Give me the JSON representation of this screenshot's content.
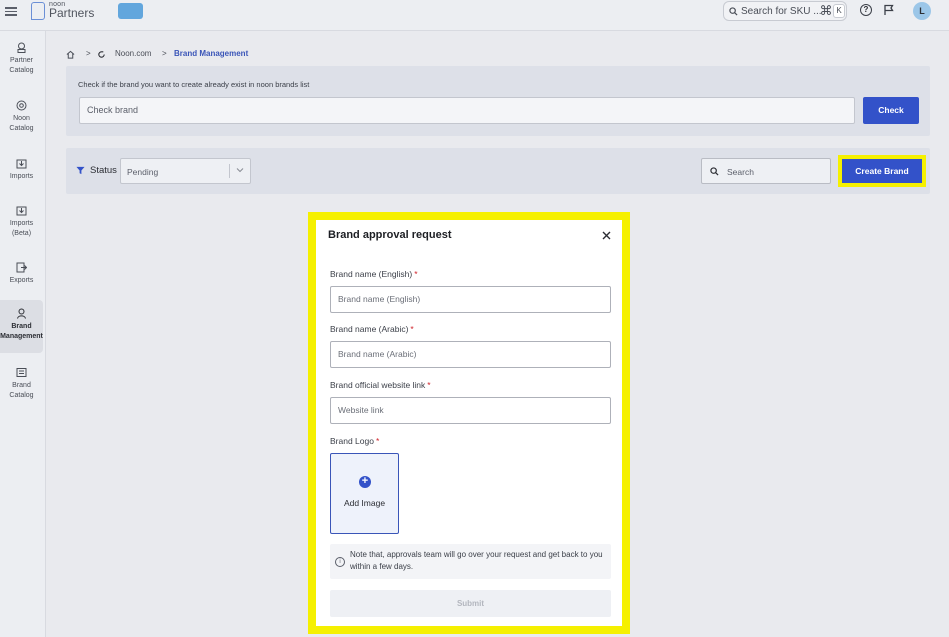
{
  "header": {
    "logo_small": "noon",
    "logo_text": "Partners",
    "search_placeholder": "Search for SKU ...",
    "shortcut_cmd": "⌘",
    "shortcut_key": "K",
    "help_glyph": "?",
    "avatar_initial": "L"
  },
  "sidebar": {
    "items": [
      {
        "line1": "Partner",
        "line2": "Catalog",
        "icon": "partner-catalog-icon"
      },
      {
        "line1": "Noon",
        "line2": "Catalog",
        "icon": "noon-catalog-icon"
      },
      {
        "line1": "Imports",
        "line2": "",
        "icon": "imports-icon"
      },
      {
        "line1": "Imports",
        "line2": "(Beta)",
        "icon": "imports-beta-icon"
      },
      {
        "line1": "Exports",
        "line2": "",
        "icon": "exports-icon"
      },
      {
        "line1": "Brand",
        "line2": "Management",
        "icon": "brand-management-icon"
      },
      {
        "line1": "Brand",
        "line2": "Catalog",
        "icon": "brand-catalog-icon"
      }
    ]
  },
  "breadcrumb": {
    "home_icon": "home-icon",
    "site": "Noon.com",
    "current": "Brand Management"
  },
  "check_panel": {
    "label": "Check if the brand you want to create already exist in noon brands list",
    "input_placeholder": "Check brand",
    "button": "Check"
  },
  "filter_panel": {
    "status_label": "Status",
    "status_value": "Pending",
    "search_placeholder": "Search",
    "create_button": "Create Brand"
  },
  "modal": {
    "title": "Brand approval request",
    "fields": [
      {
        "label": "Brand name (English)",
        "placeholder": "Brand name (English)",
        "required": "*"
      },
      {
        "label": "Brand name (Arabic)",
        "placeholder": "Brand name (Arabic)",
        "required": "*"
      },
      {
        "label": "Brand official website link",
        "placeholder": "Website link",
        "required": "*"
      }
    ],
    "logo_label": "Brand Logo",
    "logo_required": "*",
    "add_image": "Add Image",
    "note": "Note that, approvals team will go over your request and get back to you within a few days.",
    "submit": "Submit"
  },
  "colors": {
    "accent": "#3352c9",
    "highlight": "#f5f000",
    "required": "#d0242b"
  }
}
